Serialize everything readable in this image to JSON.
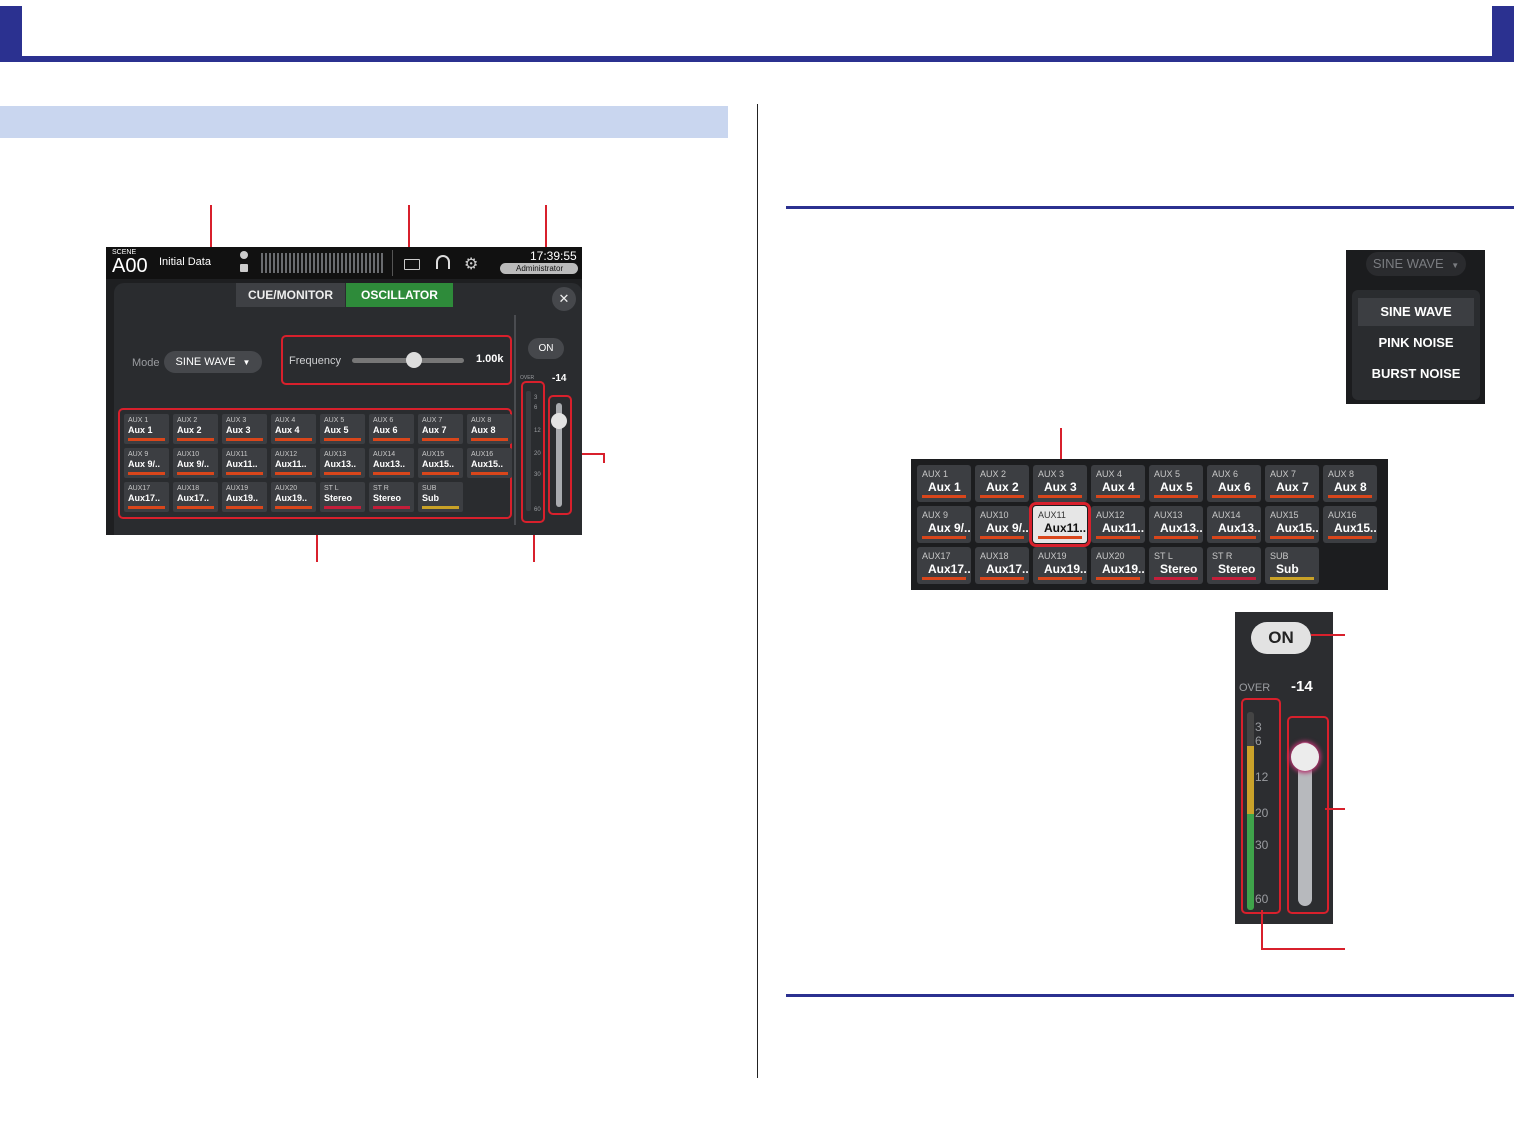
{
  "screen": {
    "scene_label": "SCENE",
    "scene_number": "A00",
    "scene_name": "Initial Data",
    "time": "17:39:55",
    "user": "Administrator",
    "tabs": [
      "CUE/MONITOR",
      "OSCILLATOR"
    ],
    "close_glyph": "✕",
    "mode_label": "Mode",
    "mode_value": "SINE WAVE",
    "frequency_label": "Frequency",
    "frequency_value": "1.00k",
    "frequency_position": 0.55,
    "on_label": "ON",
    "level_value": "-14",
    "over_label": "OVER",
    "meter_scale": [
      "3",
      "6",
      "12",
      "20",
      "30",
      "60"
    ],
    "fader_position": 0.92,
    "buses": [
      {
        "id": "AUX 1",
        "name": "Aux 1",
        "color": "#d9461b"
      },
      {
        "id": "AUX 2",
        "name": "Aux 2",
        "color": "#d9461b"
      },
      {
        "id": "AUX 3",
        "name": "Aux 3",
        "color": "#d9461b"
      },
      {
        "id": "AUX 4",
        "name": "Aux 4",
        "color": "#d9461b"
      },
      {
        "id": "AUX 5",
        "name": "Aux 5",
        "color": "#d9461b"
      },
      {
        "id": "AUX 6",
        "name": "Aux 6",
        "color": "#d9461b"
      },
      {
        "id": "AUX 7",
        "name": "Aux 7",
        "color": "#d9461b"
      },
      {
        "id": "AUX 8",
        "name": "Aux 8",
        "color": "#d9461b"
      },
      {
        "id": "AUX 9",
        "name": "Aux 9/..",
        "color": "#d9461b"
      },
      {
        "id": "AUX10",
        "name": "Aux 9/..",
        "color": "#d9461b"
      },
      {
        "id": "AUX11",
        "name": "Aux11..",
        "color": "#d9461b"
      },
      {
        "id": "AUX12",
        "name": "Aux11..",
        "color": "#d9461b"
      },
      {
        "id": "AUX13",
        "name": "Aux13..",
        "color": "#d9461b"
      },
      {
        "id": "AUX14",
        "name": "Aux13..",
        "color": "#d9461b"
      },
      {
        "id": "AUX15",
        "name": "Aux15..",
        "color": "#d9461b"
      },
      {
        "id": "AUX16",
        "name": "Aux15..",
        "color": "#d9461b"
      },
      {
        "id": "AUX17",
        "name": "Aux17..",
        "color": "#d9461b"
      },
      {
        "id": "AUX18",
        "name": "Aux17..",
        "color": "#d9461b"
      },
      {
        "id": "AUX19",
        "name": "Aux19..",
        "color": "#d9461b"
      },
      {
        "id": "AUX20",
        "name": "Aux19..",
        "color": "#d9461b"
      },
      {
        "id": "ST L",
        "name": "Stereo",
        "color": "#c41e3a"
      },
      {
        "id": "ST R",
        "name": "Stereo",
        "color": "#c41e3a"
      },
      {
        "id": "SUB",
        "name": "Sub",
        "color": "#c9a227"
      }
    ]
  },
  "mode_menu": {
    "selected": "SINE WAVE",
    "options": [
      "SINE WAVE",
      "PINK NOISE",
      "BURST NOISE"
    ]
  },
  "bus_grid_zoom": {
    "selected_index": 10
  },
  "fader_zoom": {
    "on_label": "ON",
    "over_label": "OVER",
    "level_value": "-14",
    "meter_scale": [
      "3",
      "6",
      "12",
      "20",
      "30",
      "60"
    ]
  }
}
